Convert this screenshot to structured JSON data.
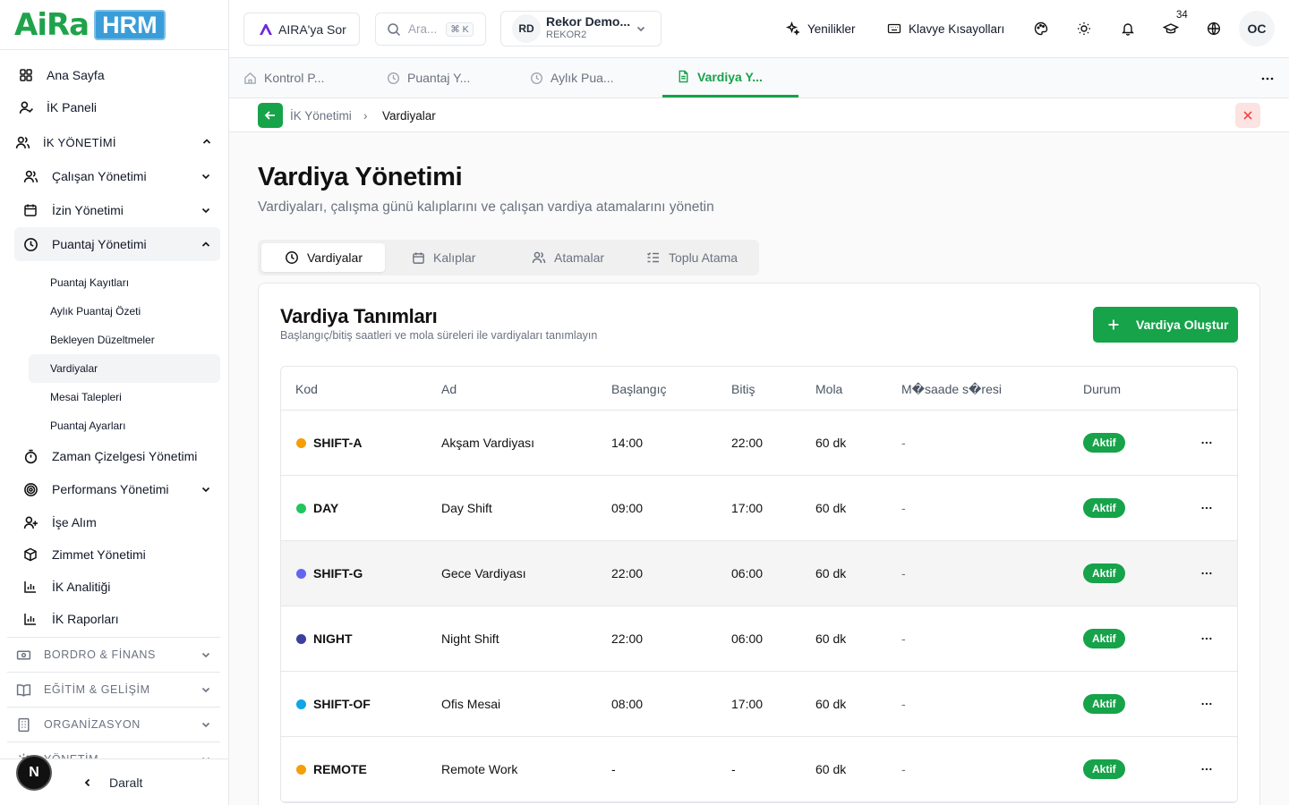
{
  "logo": {
    "aira": "AiRa",
    "hrm": "HRM"
  },
  "sidebar": {
    "top_items": [
      {
        "label": "Ana Sayfa",
        "icon": "grid-icon"
      },
      {
        "label": "İK Paneli",
        "icon": "user-check-icon"
      }
    ],
    "section": {
      "label": "İK YÖNETİMİ",
      "icon": "users-icon"
    },
    "sub_items": [
      {
        "label": "Çalışan Yönetimi",
        "icon": "users-icon"
      },
      {
        "label": "İzin Yönetimi",
        "icon": "calendar-icon"
      },
      {
        "label": "Puantaj Yönetimi",
        "icon": "clock-icon"
      }
    ],
    "leaves": [
      {
        "label": "Puantaj Kayıtları"
      },
      {
        "label": "Aylık Puantaj Özeti"
      },
      {
        "label": "Bekleyen Düzeltmeler"
      },
      {
        "label": "Vardiyalar"
      },
      {
        "label": "Mesai Talepleri"
      },
      {
        "label": "Puantaj Ayarları"
      }
    ],
    "more_items": [
      {
        "label": "Zaman Çizelgesi Yönetimi",
        "icon": "timer-icon"
      },
      {
        "label": "Performans Yönetimi",
        "icon": "target-icon"
      },
      {
        "label": "İşe Alım",
        "icon": "user-plus-icon"
      },
      {
        "label": "Zimmet Yönetimi",
        "icon": "box-icon"
      },
      {
        "label": "İK Analitiği",
        "icon": "bar-chart-icon"
      },
      {
        "label": "İK Raporları",
        "icon": "bar-chart-icon"
      }
    ],
    "groups": [
      {
        "label": "BORDRO & FİNANS",
        "icon": "banknote-icon"
      },
      {
        "label": "EĞİTİM & GELİŞİM",
        "icon": "book-icon"
      },
      {
        "label": "ORGANİZASYON",
        "icon": "building-icon"
      },
      {
        "label": "YÖNETİM",
        "icon": "settings-icon"
      }
    ],
    "collapse_label": "Daralt",
    "n_badge": "N"
  },
  "topbar": {
    "ask_label": "AIRA'ya Sor",
    "search_placeholder": "Ara...",
    "search_shortcut": "⌘ K",
    "company_initials": "RD",
    "company_name": "Rekor Demo...",
    "company_code": "REKOR2",
    "news_label": "Yenilikler",
    "shortcuts_label": "Klavye Kısayolları",
    "badge_count": "34",
    "avatar": "OC"
  },
  "page_tabs": [
    {
      "label": "Kontrol P...",
      "icon": "home-icon"
    },
    {
      "label": "Puantaj Y...",
      "icon": "clock-icon"
    },
    {
      "label": "Aylık Pua...",
      "icon": "clock-icon"
    },
    {
      "label": "Vardiya Y...",
      "icon": "file-icon"
    }
  ],
  "breadcrumb": {
    "parent": "İK Yönetimi",
    "separator": "›",
    "current": "Vardiyalar"
  },
  "page": {
    "title": "Vardiya Yönetimi",
    "subtitle": "Vardiyaları, çalışma günü kalıplarını ve çalışan vardiya atamalarını yönetin"
  },
  "tabs": [
    {
      "label": "Vardiyalar",
      "icon": "clock-icon"
    },
    {
      "label": "Kalıplar",
      "icon": "calendar-icon"
    },
    {
      "label": "Atamalar",
      "icon": "users-icon"
    },
    {
      "label": "Toplu Atama",
      "icon": "list-check-icon"
    }
  ],
  "card": {
    "title": "Vardiya Tanımları",
    "subtitle": "Başlangıç/bitiş saatleri ve mola süreleri ile vardiyaları tanımlayın",
    "create_label": "Vardiya Oluştur"
  },
  "table": {
    "headers": [
      "Kod",
      "Ad",
      "Başlangıç",
      "Bitiş",
      "Mola",
      "M�saade s�resi",
      "Durum"
    ],
    "rows": [
      {
        "color": "#f59e0b",
        "code": "SHIFT-A",
        "name": "Akşam Vardiyası",
        "start": "14:00",
        "end": "22:00",
        "break": "60 dk",
        "grace": "-",
        "status": "Aktif"
      },
      {
        "color": "#22c55e",
        "code": "DAY",
        "name": "Day Shift",
        "start": "09:00",
        "end": "17:00",
        "break": "60 dk",
        "grace": "-",
        "status": "Aktif"
      },
      {
        "color": "#6366f1",
        "code": "SHIFT-G",
        "name": "Gece Vardiyası",
        "start": "22:00",
        "end": "06:00",
        "break": "60 dk",
        "grace": "-",
        "status": "Aktif"
      },
      {
        "color": "#3b3f9e",
        "code": "NIGHT",
        "name": "Night Shift",
        "start": "22:00",
        "end": "06:00",
        "break": "60 dk",
        "grace": "-",
        "status": "Aktif"
      },
      {
        "color": "#0ea5e9",
        "code": "SHIFT-OF",
        "name": "Ofis Mesai",
        "start": "08:00",
        "end": "17:00",
        "break": "60 dk",
        "grace": "-",
        "status": "Aktif"
      },
      {
        "color": "#f59e0b",
        "code": "REMOTE",
        "name": "Remote Work",
        "start": "-",
        "end": "-",
        "break": "60 dk",
        "grace": "-",
        "status": "Aktif"
      }
    ]
  },
  "colors": {
    "brand_green": "#16a34a",
    "logo_blue": "#3b9dd8"
  }
}
